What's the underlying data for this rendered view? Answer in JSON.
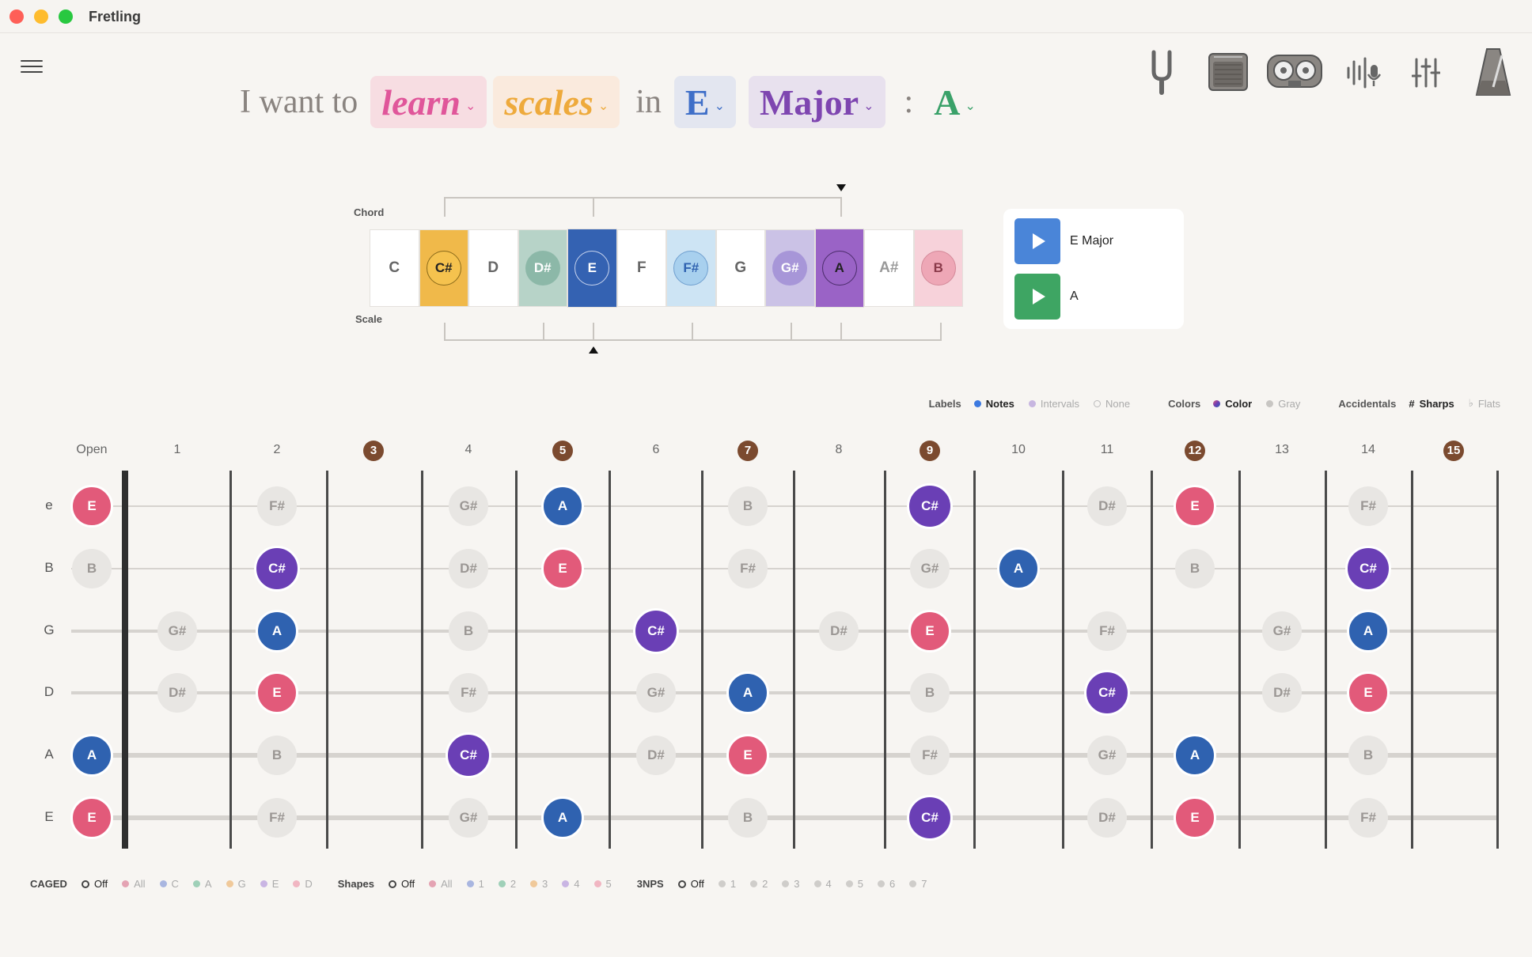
{
  "app": {
    "title": "Fretling"
  },
  "sentence": {
    "prefix": "I want to",
    "verb": "learn",
    "topic": "scales",
    "in": "in",
    "key": "E",
    "mode": "Major",
    "colon": ":",
    "chord": "A"
  },
  "toolbar": [
    "tuning-fork-icon",
    "amplifier-icon",
    "tape-recorder-icon",
    "microphone-waveform-icon",
    "mixer-sliders-icon",
    "metronome-icon"
  ],
  "strip": {
    "chord_label": "Chord",
    "scale_label": "Scale",
    "notes": [
      {
        "name": "C",
        "bg": "#ffffff",
        "circle": null,
        "text": "#666666"
      },
      {
        "name": "C#",
        "bg": "#f0b94a",
        "circle": "#f5c24e",
        "text": "#222222",
        "ring": "#8a6a1a"
      },
      {
        "name": "D",
        "bg": "#ffffff",
        "circle": null,
        "text": "#666666"
      },
      {
        "name": "D#",
        "bg": "#b7d3c8",
        "circle": "#8cb8a8",
        "text": "#ffffff"
      },
      {
        "name": "E",
        "bg": "#3462b2",
        "circle": "#3462b2",
        "text": "#ffffff",
        "ring": "#c8d4ee"
      },
      {
        "name": "F",
        "bg": "#ffffff",
        "circle": null,
        "text": "#666666"
      },
      {
        "name": "F#",
        "bg": "#cde4f4",
        "circle": "#a8d0ee",
        "text": "#2f62b0",
        "ring": "#6f9fcf"
      },
      {
        "name": "G",
        "bg": "#ffffff",
        "circle": null,
        "text": "#666666"
      },
      {
        "name": "G#",
        "bg": "#cbc2e6",
        "circle": "#a796d8",
        "text": "#ffffff"
      },
      {
        "name": "A",
        "bg": "#9a63c6",
        "circle": "#9a63c6",
        "text": "#222222",
        "ring": "#4a2c6a"
      },
      {
        "name": "A#",
        "bg": "#ffffff",
        "circle": null,
        "text": "#999999"
      },
      {
        "name": "B",
        "bg": "#f7d2da",
        "circle": "#eea7b6",
        "text": "#8a3a4a",
        "ring": "#d48999"
      }
    ]
  },
  "chord_card": {
    "rows": [
      {
        "label": "E Major",
        "color": "#4a85d8"
      },
      {
        "label": "A",
        "color": "#3ea563"
      }
    ]
  },
  "options": {
    "labels": {
      "title": "Labels",
      "items": [
        {
          "label": "Notes",
          "selected": true,
          "dot": "#3d7ae0"
        },
        {
          "label": "Intervals",
          "selected": false,
          "dot": "#c7b6e0"
        },
        {
          "label": "None",
          "selected": false,
          "dot": "ring"
        }
      ]
    },
    "colors": {
      "title": "Colors",
      "items": [
        {
          "label": "Color",
          "selected": true,
          "dot": "#7a4ab0"
        },
        {
          "label": "Gray",
          "selected": false,
          "dot": "#c8c6c3"
        }
      ]
    },
    "accidentals": {
      "title": "Accidentals",
      "items": [
        {
          "label": "Sharps",
          "selected": true,
          "symbol": "#"
        },
        {
          "label": "Flats",
          "selected": false,
          "symbol": "♭"
        }
      ]
    }
  },
  "fretboard": {
    "fret_labels": [
      "Open",
      "1",
      "2",
      "3",
      "4",
      "5",
      "6",
      "7",
      "8",
      "9",
      "10",
      "11",
      "12",
      "13",
      "14",
      "15"
    ],
    "marker_frets": [
      3,
      5,
      7,
      9,
      12,
      15
    ],
    "strings": [
      {
        "name": "e",
        "notes": [
          {
            "fret": 0,
            "n": "E",
            "t": "root"
          },
          {
            "fret": 2,
            "n": "F#",
            "t": "gray"
          },
          {
            "fret": 4,
            "n": "G#",
            "t": "gray"
          },
          {
            "fret": 5,
            "n": "A",
            "t": "fifth"
          },
          {
            "fret": 7,
            "n": "B",
            "t": "gray"
          },
          {
            "fret": 9,
            "n": "C#",
            "t": "third"
          },
          {
            "fret": 11,
            "n": "D#",
            "t": "gray"
          },
          {
            "fret": 12,
            "n": "E",
            "t": "root"
          },
          {
            "fret": 14,
            "n": "F#",
            "t": "gray"
          }
        ]
      },
      {
        "name": "B",
        "notes": [
          {
            "fret": 0,
            "n": "B",
            "t": "gray"
          },
          {
            "fret": 2,
            "n": "C#",
            "t": "third"
          },
          {
            "fret": 4,
            "n": "D#",
            "t": "gray"
          },
          {
            "fret": 5,
            "n": "E",
            "t": "root"
          },
          {
            "fret": 7,
            "n": "F#",
            "t": "gray"
          },
          {
            "fret": 9,
            "n": "G#",
            "t": "gray"
          },
          {
            "fret": 10,
            "n": "A",
            "t": "fifth"
          },
          {
            "fret": 12,
            "n": "B",
            "t": "gray"
          },
          {
            "fret": 14,
            "n": "C#",
            "t": "third"
          }
        ]
      },
      {
        "name": "G",
        "notes": [
          {
            "fret": 1,
            "n": "G#",
            "t": "gray"
          },
          {
            "fret": 2,
            "n": "A",
            "t": "fifth"
          },
          {
            "fret": 4,
            "n": "B",
            "t": "gray"
          },
          {
            "fret": 6,
            "n": "C#",
            "t": "third"
          },
          {
            "fret": 8,
            "n": "D#",
            "t": "gray"
          },
          {
            "fret": 9,
            "n": "E",
            "t": "root"
          },
          {
            "fret": 11,
            "n": "F#",
            "t": "gray"
          },
          {
            "fret": 13,
            "n": "G#",
            "t": "gray"
          },
          {
            "fret": 14,
            "n": "A",
            "t": "fifth"
          }
        ]
      },
      {
        "name": "D",
        "notes": [
          {
            "fret": 1,
            "n": "D#",
            "t": "gray"
          },
          {
            "fret": 2,
            "n": "E",
            "t": "root"
          },
          {
            "fret": 4,
            "n": "F#",
            "t": "gray"
          },
          {
            "fret": 6,
            "n": "G#",
            "t": "gray"
          },
          {
            "fret": 7,
            "n": "A",
            "t": "fifth"
          },
          {
            "fret": 9,
            "n": "B",
            "t": "gray"
          },
          {
            "fret": 11,
            "n": "C#",
            "t": "third"
          },
          {
            "fret": 13,
            "n": "D#",
            "t": "gray"
          },
          {
            "fret": 14,
            "n": "E",
            "t": "root"
          }
        ]
      },
      {
        "name": "A",
        "notes": [
          {
            "fret": 0,
            "n": "A",
            "t": "fifth"
          },
          {
            "fret": 2,
            "n": "B",
            "t": "gray"
          },
          {
            "fret": 4,
            "n": "C#",
            "t": "third"
          },
          {
            "fret": 6,
            "n": "D#",
            "t": "gray"
          },
          {
            "fret": 7,
            "n": "E",
            "t": "root"
          },
          {
            "fret": 9,
            "n": "F#",
            "t": "gray"
          },
          {
            "fret": 11,
            "n": "G#",
            "t": "gray"
          },
          {
            "fret": 12,
            "n": "A",
            "t": "fifth"
          },
          {
            "fret": 14,
            "n": "B",
            "t": "gray"
          }
        ]
      },
      {
        "name": "E",
        "notes": [
          {
            "fret": 0,
            "n": "E",
            "t": "root"
          },
          {
            "fret": 2,
            "n": "F#",
            "t": "gray"
          },
          {
            "fret": 4,
            "n": "G#",
            "t": "gray"
          },
          {
            "fret": 5,
            "n": "A",
            "t": "fifth"
          },
          {
            "fret": 7,
            "n": "B",
            "t": "gray"
          },
          {
            "fret": 9,
            "n": "C#",
            "t": "third"
          },
          {
            "fret": 11,
            "n": "D#",
            "t": "gray"
          },
          {
            "fret": 12,
            "n": "E",
            "t": "root"
          },
          {
            "fret": 14,
            "n": "F#",
            "t": "gray"
          }
        ]
      }
    ]
  },
  "bottom": {
    "caged": {
      "title": "CAGED",
      "items": [
        {
          "label": "Off",
          "selected": true,
          "dot": "ring"
        },
        {
          "label": "All",
          "dot": "#e4a3b3"
        },
        {
          "label": "C",
          "dot": "#a9b6e0"
        },
        {
          "label": "A",
          "dot": "#9fd0b8"
        },
        {
          "label": "G",
          "dot": "#f0c99a"
        },
        {
          "label": "E",
          "dot": "#c9b5e3"
        },
        {
          "label": "D",
          "dot": "#f1b6c2"
        }
      ]
    },
    "shapes": {
      "title": "Shapes",
      "items": [
        {
          "label": "Off",
          "selected": true,
          "dot": "ring"
        },
        {
          "label": "All",
          "dot": "#e4a3b3"
        },
        {
          "label": "1",
          "dot": "#a9b6e0"
        },
        {
          "label": "2",
          "dot": "#9fd0b8"
        },
        {
          "label": "3",
          "dot": "#f0c99a"
        },
        {
          "label": "4",
          "dot": "#c9b5e3"
        },
        {
          "label": "5",
          "dot": "#f1b6c2"
        }
      ]
    },
    "nps": {
      "title": "3NPS",
      "items": [
        {
          "label": "Off",
          "selected": true,
          "dot": "ring"
        },
        {
          "label": "1",
          "dot": "#cfcdca"
        },
        {
          "label": "2",
          "dot": "#cfcdca"
        },
        {
          "label": "3",
          "dot": "#cfcdca"
        },
        {
          "label": "4",
          "dot": "#cfcdca"
        },
        {
          "label": "5",
          "dot": "#cfcdca"
        },
        {
          "label": "6",
          "dot": "#cfcdca"
        },
        {
          "label": "7",
          "dot": "#cfcdca"
        }
      ]
    }
  }
}
